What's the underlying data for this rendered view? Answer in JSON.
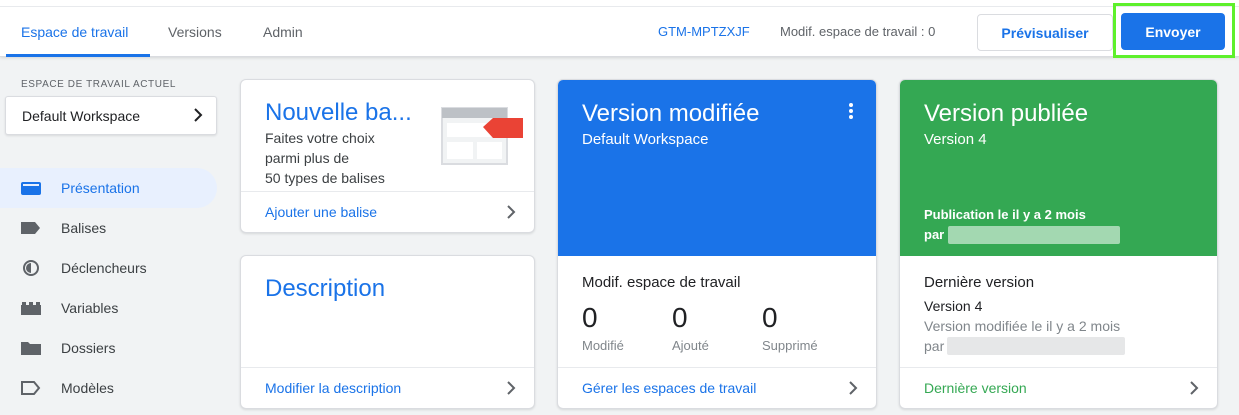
{
  "header": {
    "tabs": [
      {
        "label": "Espace de travail",
        "active": true
      },
      {
        "label": "Versions",
        "active": false
      },
      {
        "label": "Admin",
        "active": false
      }
    ],
    "container_id": "GTM-MPTZXJF",
    "workspace_changes": "Modif. espace de travail : 0",
    "preview_label": "Prévisualiser",
    "submit_label": "Envoyer"
  },
  "sidebar": {
    "workspace_label": "ESPACE DE TRAVAIL ACTUEL",
    "workspace_name": "Default Workspace",
    "items": [
      {
        "label": "Présentation",
        "icon": "overview-icon",
        "active": true
      },
      {
        "label": "Balises",
        "icon": "tag-icon",
        "active": false
      },
      {
        "label": "Déclencheurs",
        "icon": "trigger-icon",
        "active": false
      },
      {
        "label": "Variables",
        "icon": "variables-icon",
        "active": false
      },
      {
        "label": "Dossiers",
        "icon": "folder-icon",
        "active": false
      },
      {
        "label": "Modèles",
        "icon": "template-icon",
        "active": false
      }
    ]
  },
  "new_tag_card": {
    "title": "Nouvelle ba...",
    "line1": "Faites votre choix",
    "line2": "parmi plus de",
    "line3": "50 types de balises",
    "link": "Ajouter une balise"
  },
  "description_card": {
    "title": "Description",
    "link": "Modifier la description"
  },
  "modified_card": {
    "title": "Version modifiée",
    "subtitle": "Default Workspace",
    "color": "#1a73e8",
    "section_title": "Modif. espace de travail",
    "stats": [
      {
        "value": "0",
        "label": "Modifié"
      },
      {
        "value": "0",
        "label": "Ajouté"
      },
      {
        "value": "0",
        "label": "Supprimé"
      }
    ],
    "link": "Gérer les espaces de travail"
  },
  "published_card": {
    "title": "Version publiée",
    "subtitle": "Version 4",
    "color": "#34a853",
    "published_when": "Publication le il y a 2 mois",
    "published_by": "par",
    "section_title": "Dernière version",
    "version": "Version 4",
    "modified_when": "Version modifiée le il y a 2 mois",
    "modified_by": "par",
    "link": "Dernière version"
  }
}
